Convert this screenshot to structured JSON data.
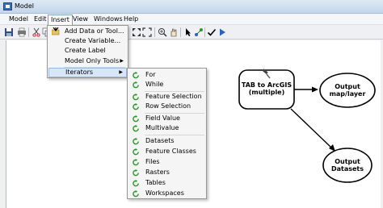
{
  "window": {
    "title": "Model"
  },
  "menubar": {
    "items": [
      "Model",
      "Edit",
      "Insert",
      "View",
      "Windows",
      "Help"
    ]
  },
  "insert_menu": {
    "items": [
      {
        "label": "Add Data or Tool...",
        "icon": "add-data-icon"
      },
      {
        "label": "Create Variable..."
      },
      {
        "label": "Create Label"
      },
      {
        "label": "Model Only Tools",
        "submenu": true
      },
      {
        "label": "Iterators",
        "submenu": true,
        "highlighted": true
      }
    ]
  },
  "iterators_menu": {
    "items": [
      "For",
      "While",
      "Feature Selection",
      "Row Selection",
      "Field Value",
      "Multivalue",
      "Datasets",
      "Feature Classes",
      "Files",
      "Rasters",
      "Tables",
      "Workspaces"
    ]
  },
  "model": {
    "tool": {
      "label_line1": "TAB to ArcGIS",
      "label_line2": "(multiple)",
      "icon": "hammer-icon"
    },
    "output1": {
      "label_line1": "Output",
      "label_line2": "map/layer"
    },
    "output2": {
      "label_line1": "Output",
      "label_line2": "Datasets"
    }
  },
  "colors": {
    "iterator_icon": "#2e9a2e",
    "highlight": "#d9e6f7",
    "run_arrow": "#2a63c4"
  }
}
